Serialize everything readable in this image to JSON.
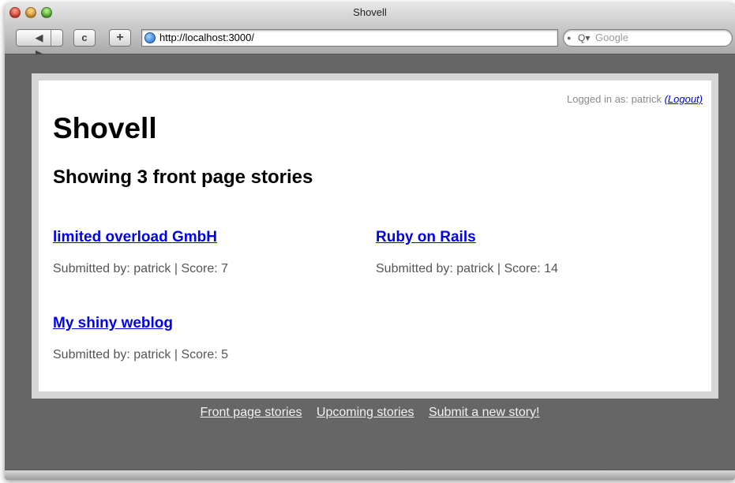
{
  "window": {
    "title": "Shovell"
  },
  "toolbar": {
    "back_icon": "◀",
    "forward_icon": "▶",
    "reload_icon": "c",
    "add_icon": "+",
    "url": "http://localhost:3000/",
    "search_placeholder": "Google",
    "search_icon": "Q▾"
  },
  "header": {
    "login_prefix": "Logged in as: patrick",
    "logout_label": "(Logout)",
    "site_title": "Shovell",
    "heading": "Showing 3 front page stories"
  },
  "stories": [
    {
      "title": "limited overload GmbH",
      "meta": "Submitted by: patrick | Score: 7"
    },
    {
      "title": "Ruby on Rails",
      "meta": "Submitted by: patrick | Score: 14"
    },
    {
      "title": "My shiny weblog",
      "meta": "Submitted by: patrick | Score: 5"
    }
  ],
  "footer": {
    "links": [
      "Front page stories",
      "Upcoming stories",
      "Submit a new story!"
    ]
  },
  "colors": {
    "link": "#0000ee",
    "page_background": "#666666",
    "card_background": "#ffffff",
    "footer_link": "#f2f2f2"
  }
}
